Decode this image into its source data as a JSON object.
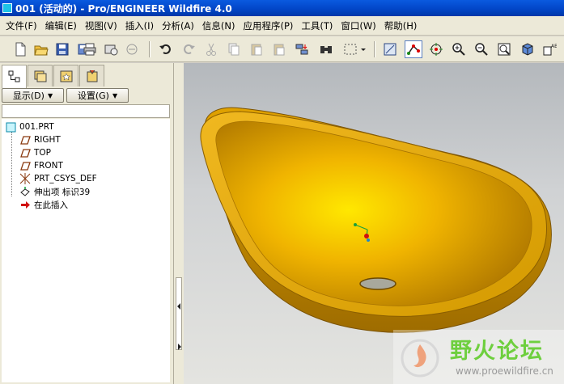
{
  "window": {
    "title": "001 (活动的) - Pro/ENGINEER Wildfire 4.0"
  },
  "menu": [
    "文件(F)",
    "编辑(E)",
    "视图(V)",
    "插入(I)",
    "分析(A)",
    "信息(N)",
    "应用程序(P)",
    "工具(T)",
    "窗口(W)",
    "帮助(H)"
  ],
  "toolbar": {
    "icons": [
      "new-file",
      "open-file",
      "save",
      "save-as",
      "print",
      "email",
      "email-link",
      "undo",
      "redo",
      "cut",
      "copy",
      "paste",
      "paste-special",
      "regenerate",
      "find",
      "select-box",
      "repaint",
      "datum-display",
      "spin-center",
      "zoom-in",
      "zoom-out",
      "refit",
      "orient",
      "saved-views"
    ]
  },
  "panel": {
    "show_label": "显示(D)",
    "settings_label": "设置(G)"
  },
  "tree": [
    {
      "label": "001.PRT",
      "icon": "part-icon"
    },
    {
      "label": "RIGHT",
      "icon": "datum-plane-icon"
    },
    {
      "label": "TOP",
      "icon": "datum-plane-icon"
    },
    {
      "label": "FRONT",
      "icon": "datum-plane-icon"
    },
    {
      "label": "PRT_CSYS_DEF",
      "icon": "csys-icon"
    },
    {
      "label": "伸出项 标识39",
      "icon": "protrusion-icon"
    },
    {
      "label": "在此插入",
      "icon": "insert-arrow-icon"
    }
  ],
  "colors": {
    "model": "#e8a800",
    "title_bar": "#0a5adf",
    "background": "#d4d0c8"
  },
  "watermark": {
    "title": "野火论坛",
    "url": "www.proewildfire.cn"
  }
}
